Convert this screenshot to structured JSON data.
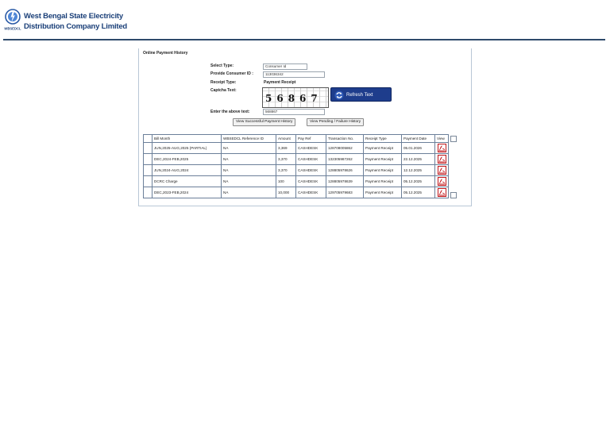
{
  "brand": {
    "line1": "West Bengal State Electricity",
    "line2": "Distribution Company Limited",
    "logo_icon": "wbsedcl-logo-icon"
  },
  "panel": {
    "title": "Online Payment History"
  },
  "form": {
    "select_type_label": "Select Type:",
    "select_type_value": "Consumer Id",
    "consumer_id_label": "Provide Consumer ID :",
    "consumer_id_value": "113036342",
    "receipt_type_label": "Receipt Type:",
    "receipt_type_value": "Payment Receipt",
    "captcha_label": "Captcha Text:",
    "captcha_text": "56867",
    "refresh_label": "Refresh Text",
    "enter_text_label": "Enter the above text:",
    "enter_text_value": "568867",
    "view_success_label": "View Successful Payment History",
    "view_pending_label": "View Pending / Failure History"
  },
  "table": {
    "headers": [
      "Bill Month",
      "WBSEDCL Reference ID",
      "Amount",
      "Pay Ref",
      "Transaction No.",
      "Receipt Type",
      "Payment Date",
      "View"
    ],
    "rows": [
      [
        "JUN,2025-AUG,2025 (PARTIAL)",
        "NA",
        "3,369",
        "CASHDESK",
        "128708005862",
        "Payment Receipt",
        "05.01.2026"
      ],
      [
        "DEC,2024-FEB,2025",
        "NA",
        "3,370",
        "CASHDESK",
        "132305987262",
        "Payment Receipt",
        "22.12.2025"
      ],
      [
        "JUN,2024-AUG,2024",
        "NA",
        "3,370",
        "CASHDESK",
        "128805978626",
        "Payment Receipt",
        "12.12.2025"
      ],
      [
        "DCRC Charge",
        "NA",
        "100",
        "CASHDESK",
        "128805978639",
        "Payment Receipt",
        "05.12.2025"
      ],
      [
        "DEC,2023-FEB,2024",
        "NA",
        "10,000",
        "CASHDESK",
        "129705979683",
        "Payment Receipt",
        "05.12.2025"
      ]
    ],
    "view_icon": "pdf-icon"
  },
  "colors": {
    "brand": "#1a3f78",
    "refresh_button": "#1e3d8c",
    "table_border": "#6b7f99",
    "pdf_red": "#c0171b"
  }
}
